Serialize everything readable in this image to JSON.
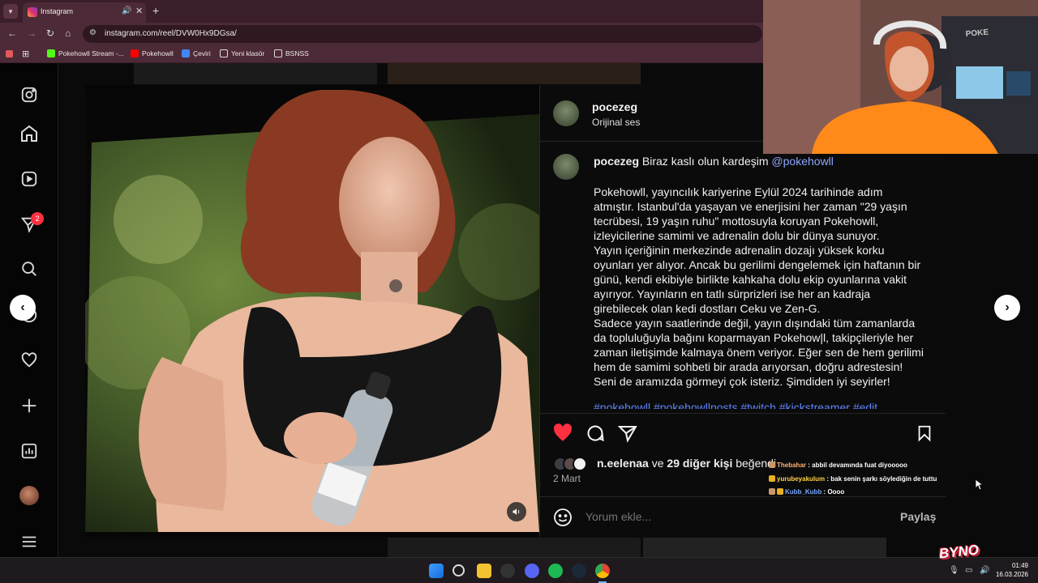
{
  "browser": {
    "tab_title": "Instagram",
    "url": "instagram.com/reel/DVW0Hx9DGsa/",
    "bookmarks": [
      "Pokehowll Stream -...",
      "Pokehowll",
      "Çeviri",
      "Yeni klasör",
      "BSNSS"
    ]
  },
  "sidebar": {
    "icons": [
      "instagram-icon",
      "home-icon",
      "reels-icon",
      "messages-icon",
      "search-icon",
      "explore-icon",
      "heart-icon",
      "create-icon",
      "dashboard-icon",
      "profile-avatar",
      "menu-icon"
    ],
    "messages_badge": "2"
  },
  "post": {
    "username": "pocezeg",
    "audio": "Orijinal ses",
    "caption_text": "Biraz kaslı olun kardeşim",
    "caption_mention": "@pokehowll",
    "caption_body": "Pokehowll, yayıncılık kariyerine Eylül 2024 tarihinde adım atmıştır. Istanbul'da yaşayan ve enerjisini her zaman \"29 yaşın tecrübesi, 19 yaşın ruhu\" mottosuyla koruyan Pokehowll, izleyicilerine samimi ve adrenalin dolu bir dünya sunuyor.\nYayın içeriğinin merkezinde adrenalin dozajı yüksek korku oyunları yer alıyor. Ancak bu gerilimi dengelemek için haftanın bir günü, kendi ekibiyle birlikte kahkaha dolu ekip oyunlarına vakit ayırıyor. Yayınların en tatlı sürprizleri ise her an kadraja girebilecek olan kedi dostları Ceku ve Zen-G.\nSadece yayın saatlerinde değil, yayın dışındaki tüm zamanlarda da topluluğuyla bağını koparmayan Pokehow|l, takipçileriyle her zaman iletişimde kalmaya önem veriyor. Eğer sen de hem gerilimi hem de samimi sohbeti bir arada arıyorsan, doğru adrestesin! Seni de aramızda görmeyi çok isteriz. Şimdiden iyi seyirler!",
    "caption_tags": "#pokehowll #pokehowllposts #twitch #kickstreamer #edit",
    "liked_by_user": "n.eelenaa",
    "liked_connector": "ve",
    "liked_others": "29 diğer kişi",
    "liked_suffix": "beğendi",
    "date": "2 Mart",
    "comment_placeholder": "Yorum ekle...",
    "share_label": "Paylaş",
    "liked": true
  },
  "chat": [
    {
      "user": "Thebahar",
      "message": "abbil devamında fuat diyooooo",
      "user_color": "#ffb37a"
    },
    {
      "user": "yurubeyakulum",
      "message": "bak senin şarkı söylediğin de tuttu",
      "user_color": "#ffd24a"
    },
    {
      "user": "Kubb_Kubb",
      "message": "Oooo",
      "user_color": "#7aa8ff"
    }
  ],
  "overlay": {
    "logo": "BYNO"
  },
  "tray": {
    "time": "01:49",
    "date": "16.03.2026"
  },
  "colors": {
    "accent_like": "#ff3040",
    "mention": "#8fa6ff",
    "chrome": "#4d2a37"
  }
}
